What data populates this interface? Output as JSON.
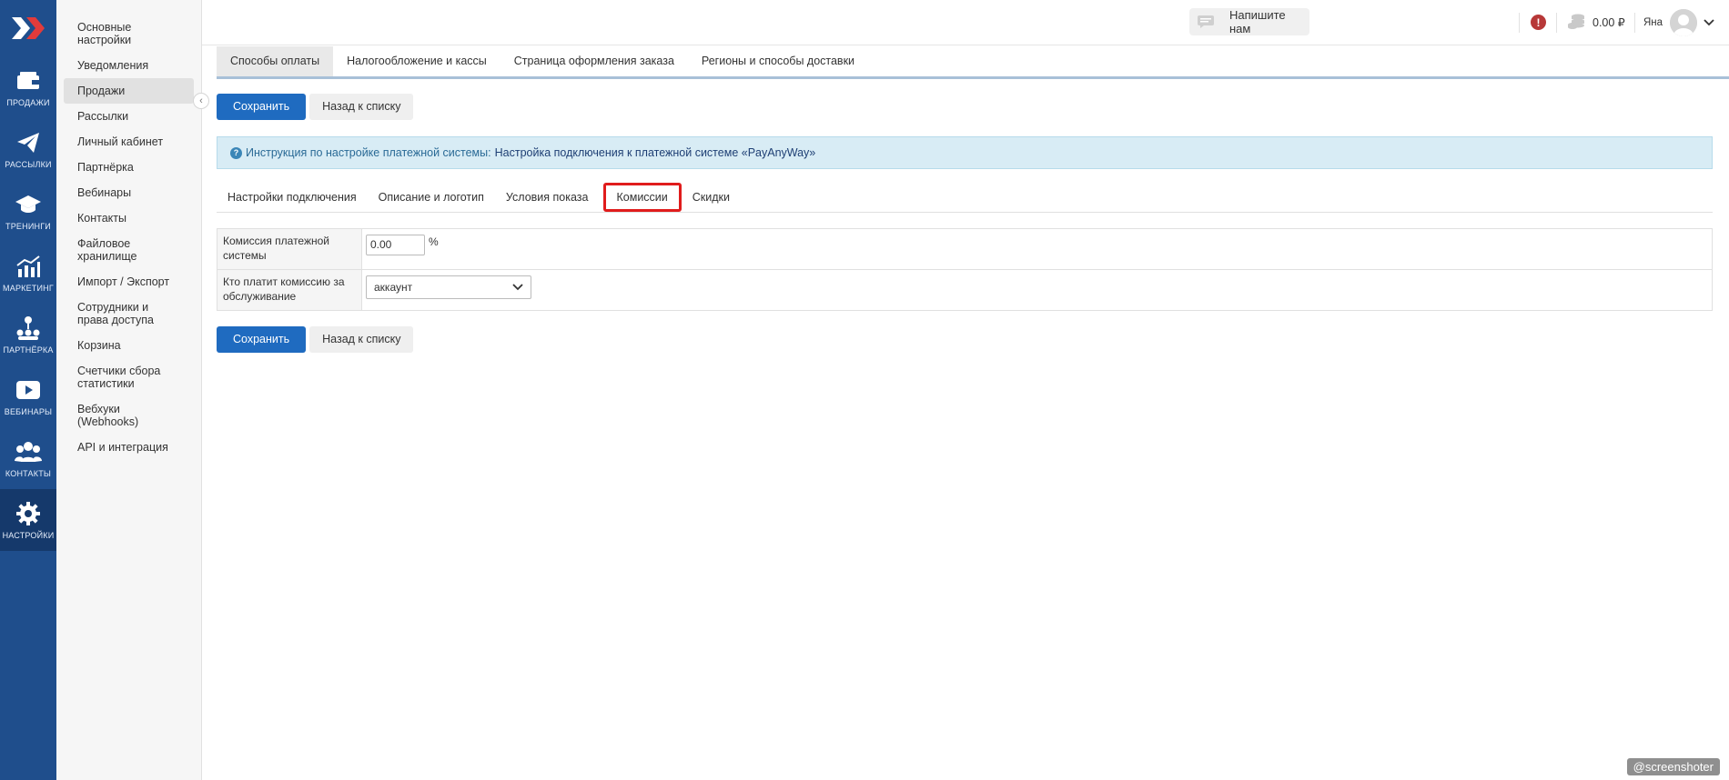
{
  "rail": {
    "items": [
      {
        "label": "ПРОДАЖИ",
        "icon": "wallet-icon"
      },
      {
        "label": "РАССЫЛКИ",
        "icon": "paper-plane-icon"
      },
      {
        "label": "ТРЕНИНГИ",
        "icon": "graduation-cap-icon"
      },
      {
        "label": "МАРКЕТИНГ",
        "icon": "growth-chart-icon"
      },
      {
        "label": "ПАРТНЁРКА",
        "icon": "partner-network-icon"
      },
      {
        "label": "ВЕБИНАРЫ",
        "icon": "play-icon"
      },
      {
        "label": "КОНТАКТЫ",
        "icon": "contacts-icon"
      },
      {
        "label": "НАСТРОЙКИ",
        "icon": "gear-icon"
      }
    ]
  },
  "submenu": {
    "items": [
      "Основные настройки",
      "Уведомления",
      "Продажи",
      "Рассылки",
      "Личный кабинет",
      "Партнёрка",
      "Вебинары",
      "Контакты",
      "Файловое хранилище",
      "Импорт / Экспорт",
      "Сотрудники и права доступа",
      "Корзина",
      "Счетчики сбора статистики",
      "Вебхуки (Webhooks)",
      "API и интеграция"
    ],
    "active": "Продажи"
  },
  "topbar": {
    "chat_label": "Напишите нам",
    "alert": "!",
    "balance": "0.00 ₽",
    "username": "Яна"
  },
  "main_tabs": [
    "Способы оплаты",
    "Налогообложение и кассы",
    "Страница оформления заказа",
    "Регионы и способы доставки"
  ],
  "buttons": {
    "save": "Сохранить",
    "back": "Назад к списку"
  },
  "info": {
    "text": "Инструкция по настройке платежной системы:",
    "link": "Настройка подключения к платежной системе «PayAnyWay»"
  },
  "sub_tabs": [
    "Настройки подключения",
    "Описание и логотип",
    "Условия показа",
    "Комиссии",
    "Скидки"
  ],
  "form": {
    "commission_label": "Комиссия платежной системы",
    "commission_value": "0.00",
    "commission_unit": "%",
    "payer_label": "Кто платит комиссию за обслуживание",
    "payer_value": "аккаунт"
  },
  "watermark": "@screenshoter",
  "colors": {
    "rail": "#1f4e8c",
    "primary": "#1f6bc0",
    "highlight": "#e01c1c",
    "info_bg": "#d8ecf5"
  }
}
